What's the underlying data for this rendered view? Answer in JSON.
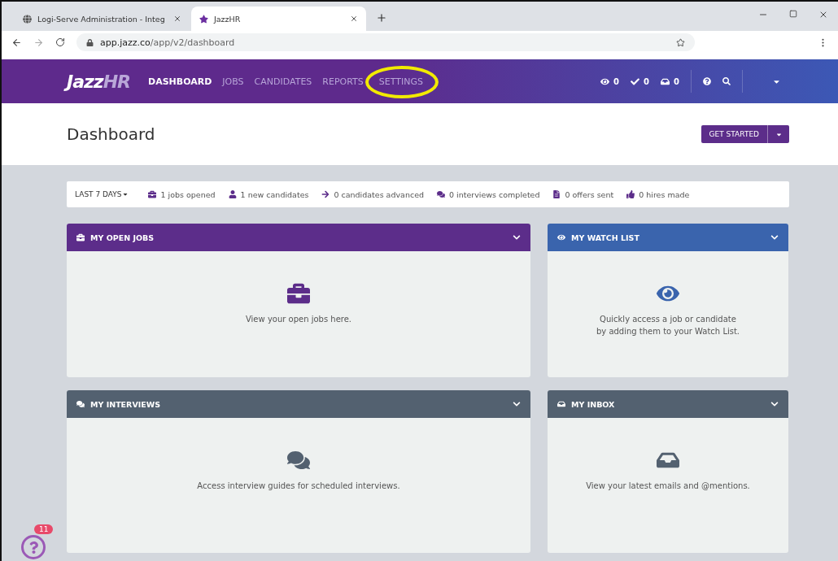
{
  "browser": {
    "tabs": [
      {
        "title": "Logi-Serve Administration - Integ",
        "selected": false,
        "kind": "globe"
      },
      {
        "title": "JazzHR",
        "selected": true,
        "kind": "star"
      }
    ],
    "url_host": "app.jazz.co",
    "url_path": "/app/v2/dashboard"
  },
  "header": {
    "logo_main": "Jazz",
    "logo_accent": "HR",
    "nav": [
      {
        "label": "DASHBOARD",
        "selected": true,
        "circled": false
      },
      {
        "label": "JOBS",
        "selected": false,
        "circled": false
      },
      {
        "label": "CANDIDATES",
        "selected": false,
        "circled": false
      },
      {
        "label": "REPORTS",
        "selected": false,
        "circled": false
      },
      {
        "label": "SETTINGS",
        "selected": false,
        "circled": true
      }
    ],
    "counters": [
      {
        "kind": "eye",
        "count": "0"
      },
      {
        "kind": "check",
        "count": "0"
      },
      {
        "kind": "inbox",
        "count": "0"
      }
    ]
  },
  "page": {
    "title": "Dashboard",
    "button": "GET STARTED"
  },
  "stats": {
    "range": "LAST 7 DAYS",
    "items": [
      {
        "kind": "briefcase",
        "text": "1 jobs opened"
      },
      {
        "kind": "user",
        "text": "1 new candidates"
      },
      {
        "kind": "arrow",
        "text": "0 candidates advanced"
      },
      {
        "kind": "chat",
        "text": "0 interviews completed"
      },
      {
        "kind": "file",
        "text": "0 offers sent"
      },
      {
        "kind": "thumb",
        "text": "0 hires made"
      }
    ]
  },
  "cards": [
    {
      "kind": "jobs",
      "title": "MY OPEN JOBS",
      "lines": [
        "View your open jobs here."
      ],
      "color": "#5c2d8a"
    },
    {
      "kind": "watch",
      "title": "MY WATCH LIST",
      "lines": [
        "Quickly access a job or candidate",
        "by adding them to your Watch List."
      ],
      "color": "#3a64ad"
    },
    {
      "kind": "interviews",
      "title": "MY INTERVIEWS",
      "lines": [
        "Access interview guides for scheduled interviews."
      ],
      "color": "#536170"
    },
    {
      "kind": "inbox",
      "title": "MY INBOX",
      "lines": [
        "View your latest emails and @mentions."
      ],
      "color": "#536170"
    }
  ],
  "help": {
    "badge": "11"
  }
}
